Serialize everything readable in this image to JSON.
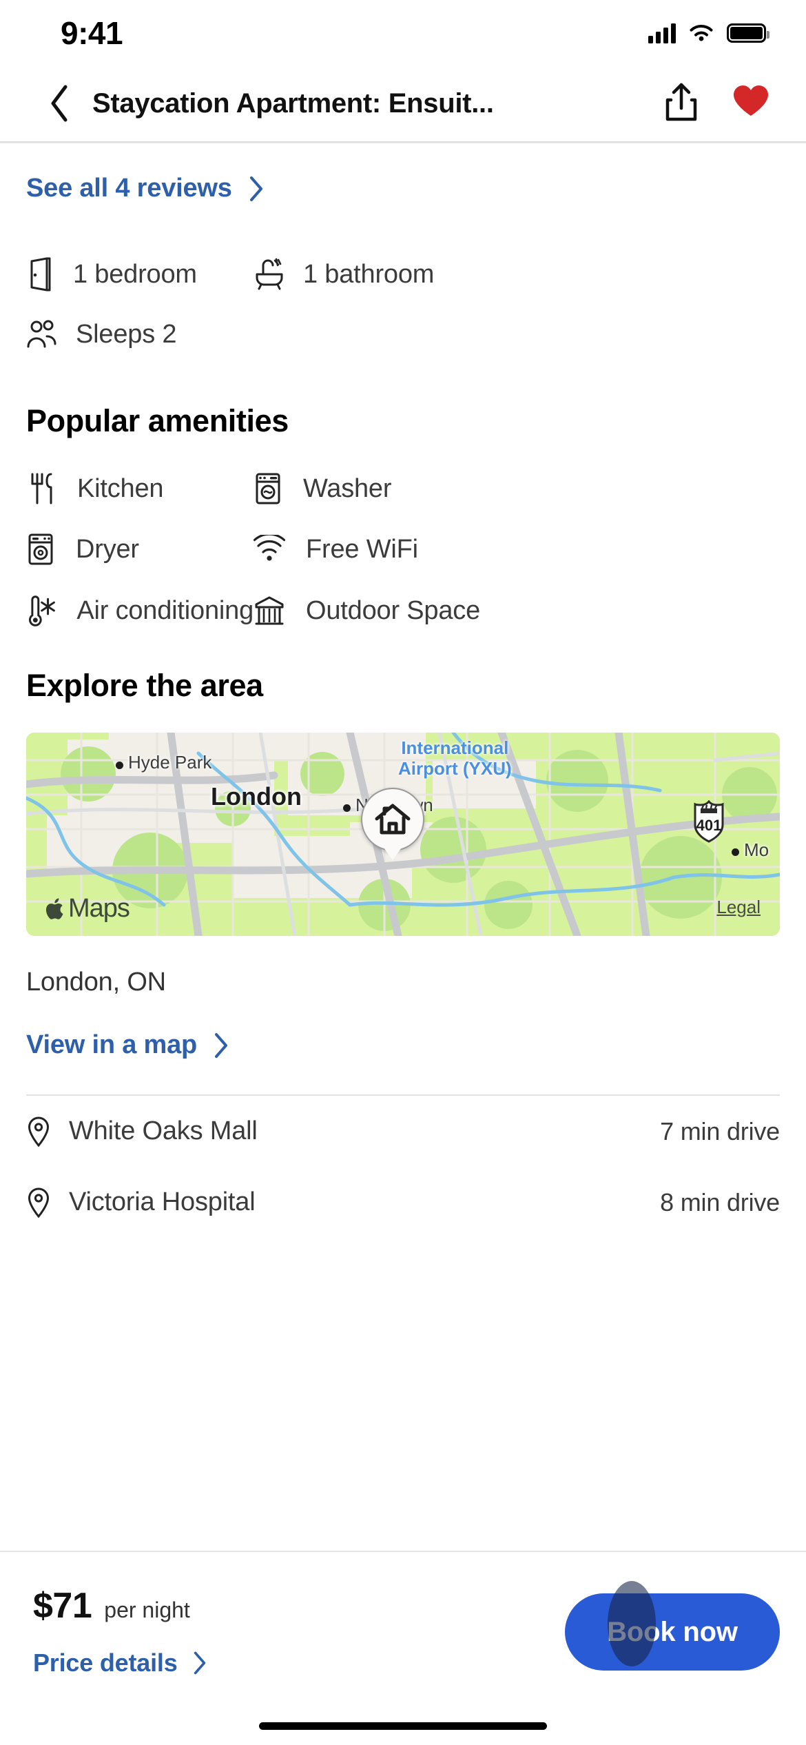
{
  "status_bar": {
    "time": "9:41",
    "signal_icon": "cellular-signal-icon",
    "wifi_icon": "wifi-icon",
    "battery_icon": "battery-icon"
  },
  "nav": {
    "back_icon": "chevron-left-icon",
    "title": "Staycation Apartment:  Ensuit...",
    "share_icon": "share-icon",
    "favorite_icon": "heart-icon",
    "favorite_color": "#d42828"
  },
  "reviews": {
    "label": "See all 4 reviews",
    "chevron": "›",
    "count": 4,
    "link_color": "#2d5faa"
  },
  "specs": [
    {
      "icon": "door-icon",
      "label": "1 bedroom"
    },
    {
      "icon": "bathtub-icon",
      "label": "1 bathroom"
    },
    {
      "icon": "guests-icon",
      "label": "Sleeps 2"
    }
  ],
  "amenities": {
    "heading": "Popular amenities",
    "items": [
      {
        "icon": "utensils-icon",
        "label": "Kitchen"
      },
      {
        "icon": "washer-icon",
        "label": "Washer"
      },
      {
        "icon": "dryer-icon",
        "label": "Dryer"
      },
      {
        "icon": "wifi-icon",
        "label": "Free WiFi"
      },
      {
        "icon": "air-conditioning-icon",
        "label": "Air conditioning"
      },
      {
        "icon": "outdoor-space-icon",
        "label": "Outdoor Space"
      }
    ]
  },
  "explore": {
    "heading": "Explore the area",
    "map": {
      "provider_logo": "apple-logo-icon",
      "provider_name": "Maps",
      "legal_label": "Legal",
      "property_marker_icon": "home-marker-icon",
      "labels": {
        "city": "London",
        "hyde_park": "Hyde Park",
        "nilestown": "Nilestown",
        "mo": "Mo",
        "airport_line1": "International",
        "airport_line2": "Airport (YXU)",
        "highway_shield": "401"
      }
    },
    "city_line": "London, ON",
    "view_map_label": "View in a map",
    "view_map_chevron": "›"
  },
  "nearby": [
    {
      "icon": "location-pin-icon",
      "name": "White Oaks Mall",
      "time": "7 min drive"
    },
    {
      "icon": "location-pin-icon",
      "name": "Victoria Hospital",
      "time": "8 min drive"
    }
  ],
  "booking": {
    "price": "$71",
    "per_night": "per night",
    "price_details_label": "Price details",
    "price_details_chevron": "›",
    "book_label": "Book now",
    "book_color": "#2a5bd7"
  }
}
